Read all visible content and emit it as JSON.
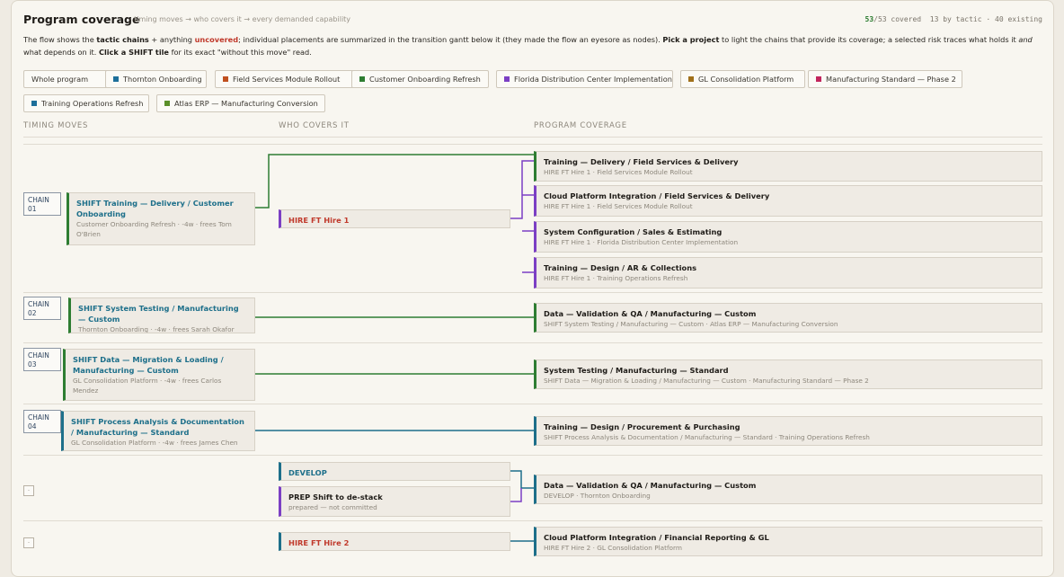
{
  "header": {
    "title": "Program coverage",
    "subtitle": "· timing moves → who covers it → every demanded capability",
    "covered": "53",
    "total": "/53 covered",
    "extra": "13 by tactic · 40 existing"
  },
  "description": {
    "p1": "The flow shows the ",
    "b1": "tactic chains",
    "p2": " + anything ",
    "red": "uncovered",
    "p3": "; individual placements are summarized in the transition gantt below it (they made the flow an eyesore as nodes). ",
    "b2": "Pick a project",
    "p4": " to light the chains that provide its coverage; a selected risk traces what holds it ",
    "it": "and",
    "p5": " what depends on it. ",
    "b3": "Click a SHIFT tile",
    "p6": " for its exact \"without this move\" read."
  },
  "projects": [
    {
      "label": "Whole program",
      "color": ""
    },
    {
      "label": "Thornton Onboarding",
      "color": "#1d6f9a"
    },
    {
      "label": "Field Services Module Rollout",
      "color": "#c0501f"
    },
    {
      "label": "Customer Onboarding Refresh",
      "color": "#2e7d32"
    },
    {
      "label": "Florida Distribution Center Implementation",
      "color": "#7b3fc4"
    },
    {
      "label": "GL Consolidation Platform",
      "color": "#a0701a"
    },
    {
      "label": "Manufacturing Standard — Phase 2",
      "color": "#c2255c"
    },
    {
      "label": "Training Operations Refresh",
      "color": "#1d6f9a"
    },
    {
      "label": "Atlas ERP — Manufacturing Conversion",
      "color": "#5a8f29"
    }
  ],
  "columns": [
    "TIMING MOVES",
    "WHO COVERS IT",
    "PROGRAM COVERAGE"
  ],
  "chains": [
    {
      "label": "CHAIN\n01"
    },
    {
      "label": "CHAIN\n02"
    },
    {
      "label": "CHAIN\n03"
    },
    {
      "label": "CHAIN\n04"
    }
  ],
  "dots": [
    "·",
    "·"
  ],
  "moves": [
    {
      "title": "SHIFT Training — Delivery / Customer Onboarding",
      "sub": "Customer Onboarding Refresh · -4w · frees Tom O'Brien"
    },
    {
      "title": "SHIFT System Testing / Manufacturing — Custom",
      "sub": "Thornton Onboarding · -4w · frees Sarah Okafor"
    },
    {
      "title": "SHIFT Data — Migration & Loading / Manufacturing — Custom",
      "sub": "GL Consolidation Platform · -4w · frees Carlos Mendez"
    },
    {
      "title": "SHIFT Process Analysis & Documentation / Manufacturing — Standard",
      "sub": "GL Consolidation Platform · -4w · frees James Chen"
    }
  ],
  "covers": [
    {
      "title": "HIRE FT Hire 1",
      "sub": ""
    },
    {
      "title": "DEVELOP",
      "sub": ""
    },
    {
      "title": "PREP Shift to de-stack",
      "sub": "prepared — not committed"
    },
    {
      "title": "HIRE FT Hire 2",
      "sub": ""
    }
  ],
  "coverage": [
    {
      "title": "Training — Delivery / Field Services & Delivery",
      "sub": "HIRE FT Hire 1 · Field Services Module Rollout"
    },
    {
      "title": "Cloud Platform Integration / Field Services & Delivery",
      "sub": "HIRE FT Hire 1 · Field Services Module Rollout"
    },
    {
      "title": "System Configuration / Sales & Estimating",
      "sub": "HIRE FT Hire 1 · Florida Distribution Center Implementation"
    },
    {
      "title": "Training — Design / AR & Collections",
      "sub": "HIRE FT Hire 1 · Training Operations Refresh"
    },
    {
      "title": "Data — Validation & QA / Manufacturing — Custom",
      "sub": "SHIFT System Testing / Manufacturing — Custom · Atlas ERP — Manufacturing Conversion"
    },
    {
      "title": "System Testing / Manufacturing — Standard",
      "sub": "SHIFT Data — Migration & Loading / Manufacturing — Custom · Manufacturing Standard — Phase 2"
    },
    {
      "title": "Training — Design / Procurement & Purchasing",
      "sub": "SHIFT Process Analysis & Documentation / Manufacturing — Standard · Training Operations Refresh"
    },
    {
      "title": "Data — Validation & QA / Manufacturing — Custom",
      "sub": "DEVELOP · Thornton Onboarding"
    },
    {
      "title": "Cloud Platform Integration / Financial Reporting & GL",
      "sub": "HIRE FT Hire 2 · GL Consolidation Platform"
    }
  ],
  "colors": {
    "green": "#2e7d32",
    "teal": "#1d6f8a",
    "purple": "#7b3fc4",
    "hire": "#c0392b"
  }
}
